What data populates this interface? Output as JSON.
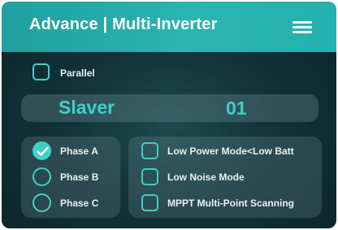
{
  "header": {
    "title": "Advance | Multi-Inverter",
    "menu_icon": "hamburger-menu-icon"
  },
  "parallel": {
    "label": "Parallel",
    "checked": false
  },
  "slave": {
    "name": "Slaver",
    "number": "01"
  },
  "phases": [
    {
      "label": "Phase A",
      "selected": true
    },
    {
      "label": "Phase B",
      "selected": false
    },
    {
      "label": "Phase C",
      "selected": false
    }
  ],
  "options": [
    {
      "label": "Low  Power Mode<Low Batt",
      "checked": false
    },
    {
      "label": "Low Noise Mode",
      "checked": false
    },
    {
      "label": "MPPT Multi-Point Scanning",
      "checked": false
    }
  ],
  "colors": {
    "accent": "#3fd0c9",
    "header_start": "#1f9f9d",
    "header_end": "#23b2ad",
    "background": "#123339"
  }
}
